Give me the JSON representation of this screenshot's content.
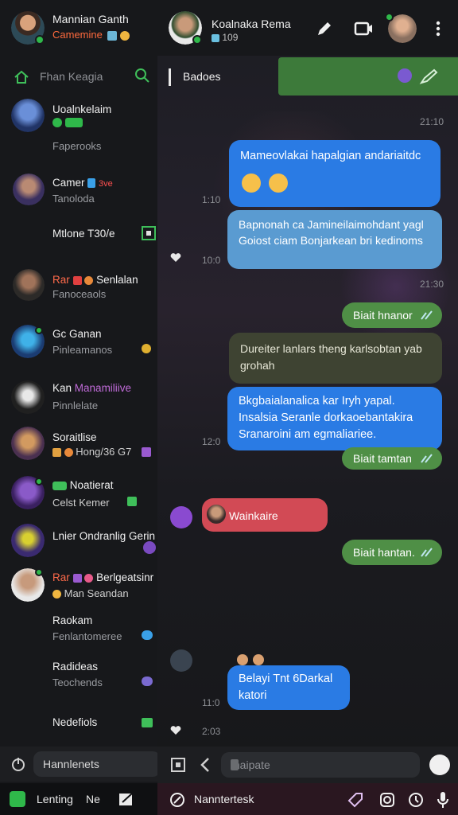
{
  "sidebar": {
    "profile": {
      "name": "Mannian Ganth",
      "subtitle": "Camemine"
    },
    "search_text": "Fhan Keagia",
    "chats": [
      {
        "name": "Uoalnkelaim",
        "sub": "Faperooks"
      },
      {
        "name": "Camer",
        "sub": "Tanoloda",
        "tag": "3ve"
      },
      {
        "name": "Mtlone T30/e",
        "sub": ""
      },
      {
        "name": "Rar",
        "extra": "Senlalan",
        "sub": "Fanoceaols"
      },
      {
        "name": "Gc Ganan",
        "sub": "Pinleamanos"
      },
      {
        "name": "Kan",
        "extra": "Manamiliive",
        "sub": "Pinnlelate"
      },
      {
        "name": "Soraitlise",
        "sub": "Hong/36 G7"
      },
      {
        "name": "Noatierat",
        "sub": "Celst Kemer"
      },
      {
        "name": "Lnier Ondranlig Gerin",
        "sub": ""
      },
      {
        "name": "Rar",
        "extra": "Berlgeatsinr",
        "sub": "Man Seandan"
      },
      {
        "name": "Raokam",
        "sub": "Fenlantomeree"
      },
      {
        "name": "Radideas",
        "sub": "Teochends"
      },
      {
        "name": "Nedefiols",
        "sub": ""
      }
    ],
    "bottom_search": "Hannlenets",
    "bottom_tabs": [
      "Lenting",
      "Ne"
    ]
  },
  "chat": {
    "title": "Koalnaka Rema",
    "subtitle": "109",
    "pinned_text": "Badoes",
    "messages": [
      {
        "time": "21:10"
      },
      {
        "text": "Mameovlakai hapalgian andariaitdc",
        "time": "1:10"
      },
      {
        "text": "Bapnonah ca Jamineilaimohdant yagl Goiost ciam Bonjarkean bri kedinoms",
        "time": "10:0"
      },
      {
        "time": "21:30"
      },
      {
        "text": "Biait hnanor"
      },
      {
        "text": "Dureiter lanlars theng karlsobtan yab grohah"
      },
      {
        "text": "Bkgbaialanalica kar Iryh yapal. Insalsia Seranle dorkaoebantakira Sranaroini am egmaliariee.",
        "time": "12:0"
      },
      {
        "text": "Biait tamtan"
      },
      {
        "text": "Wainkaire"
      },
      {
        "text": "Biait hantan."
      },
      {
        "text": "Belayi Tnt 6Darkal katori",
        "time": "11:0"
      },
      {
        "time": "2:03"
      }
    ],
    "composer_placeholder": "Inaipate",
    "bottom_text": "Nanntertesk"
  },
  "colors": {
    "accent_green": "#4f8f46",
    "bubble_blue": "#2a7be4",
    "bubble_red": "#d24a55",
    "sidebar_bg": "#17181b"
  }
}
